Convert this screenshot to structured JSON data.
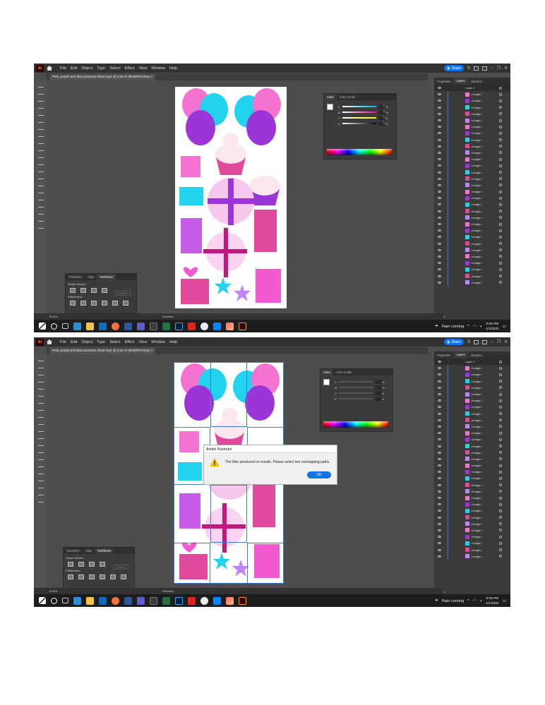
{
  "app": {
    "logo": "Ai",
    "menus": [
      "File",
      "Edit",
      "Object",
      "Type",
      "Select",
      "Effect",
      "View",
      "Window",
      "Help"
    ],
    "share_label": "Share",
    "document_tab": "Pink, purple and blue presents sheet.svg* @ 6.64 % (RGB/Preview)",
    "close_glyph": "×"
  },
  "color_panel": {
    "tabs": [
      "Color",
      "Color Guide"
    ],
    "channels": [
      "C",
      "M",
      "Y",
      "K"
    ],
    "values_top": [
      "0",
      "0",
      "0",
      "0"
    ],
    "unit": "%"
  },
  "pathfinder_panel": {
    "tabs": [
      "Transform",
      "Align",
      "Pathfinder"
    ],
    "shape_modes_label": "Shape Modes:",
    "pathfinders_label": "Pathfinders:",
    "expand_label": "Expand"
  },
  "layers_panel": {
    "tabs": [
      "Properties",
      "Layers",
      "Libraries"
    ],
    "layer_name": "Layer 1",
    "item_label": "<Image>",
    "item_count": 30,
    "footer": "1 Layer"
  },
  "status": {
    "zoom": "6.64%",
    "tool": "Selection"
  },
  "taskbar": {
    "weather": "Rain coming",
    "time": "8:06 PM",
    "date": "1/1/2022"
  },
  "dialog": {
    "title": "Adobe Illustrator",
    "message": "The filter produced no results. Please select two overlapping paths.",
    "ok": "OK"
  },
  "colors": {
    "pink": "#f25bd0",
    "purple": "#9b35d8",
    "cyan": "#22d3ee",
    "accent": "#1473e6"
  }
}
